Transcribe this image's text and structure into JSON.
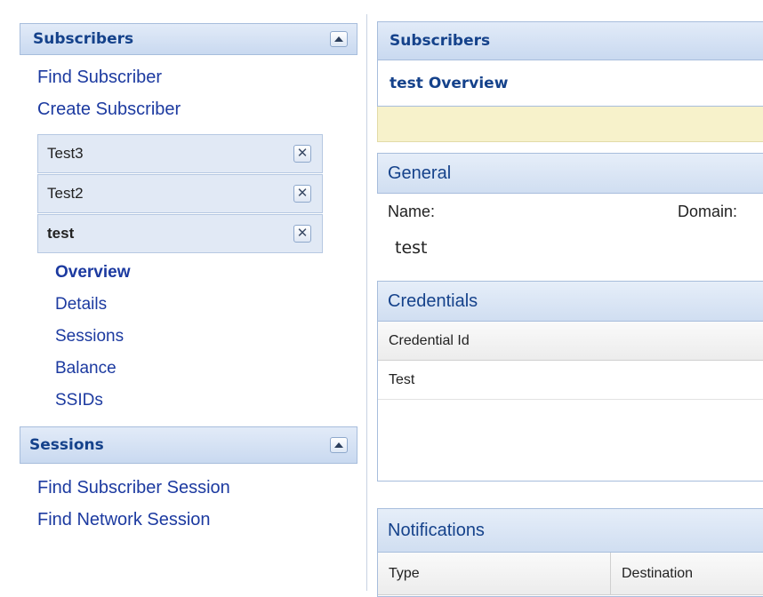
{
  "sidebar": {
    "subscribers_panel": {
      "title": "Subscribers",
      "links": [
        "Find Subscriber",
        "Create Subscriber"
      ],
      "open_subscribers": [
        {
          "label": "Test3"
        },
        {
          "label": "Test2"
        },
        {
          "label": "test",
          "active": true
        }
      ],
      "close_glyph": "✕",
      "subnav": [
        "Overview",
        "Details",
        "Sessions",
        "Balance",
        "SSIDs"
      ],
      "subnav_active": "Overview"
    },
    "sessions_panel": {
      "title": "Sessions",
      "links": [
        "Find Subscriber Session",
        "Find Network Session"
      ]
    }
  },
  "main": {
    "header": "Subscribers",
    "overview_title": "test Overview",
    "general": {
      "title": "General",
      "name_label": "Name:",
      "domain_label": "Domain:",
      "name_value": "test"
    },
    "credentials": {
      "title": "Credentials",
      "columns": [
        "Credential Id"
      ],
      "rows": [
        [
          "Test"
        ]
      ]
    },
    "notifications": {
      "title": "Notifications",
      "columns": [
        "Type",
        "Destination"
      ]
    }
  },
  "colors": {
    "header_text": "#15428b",
    "link": "#1c3aa0",
    "status_bar": "#f7f2cb"
  }
}
